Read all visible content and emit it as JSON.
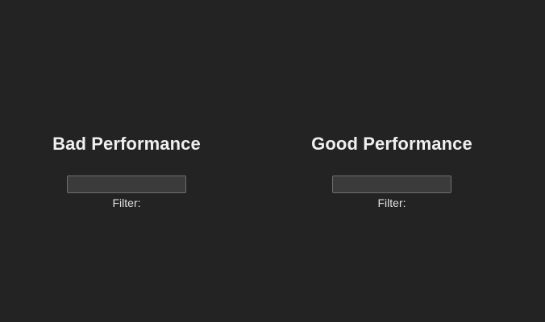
{
  "panels": [
    {
      "title": "Bad Performance",
      "filter": {
        "value": "",
        "label": "Filter:"
      }
    },
    {
      "title": "Good Performance",
      "filter": {
        "value": "",
        "label": "Filter:"
      }
    }
  ],
  "colors": {
    "background": "#232323",
    "text": "#efefef",
    "input_background": "#3b3b3b",
    "input_border": "#6e6e6e"
  }
}
